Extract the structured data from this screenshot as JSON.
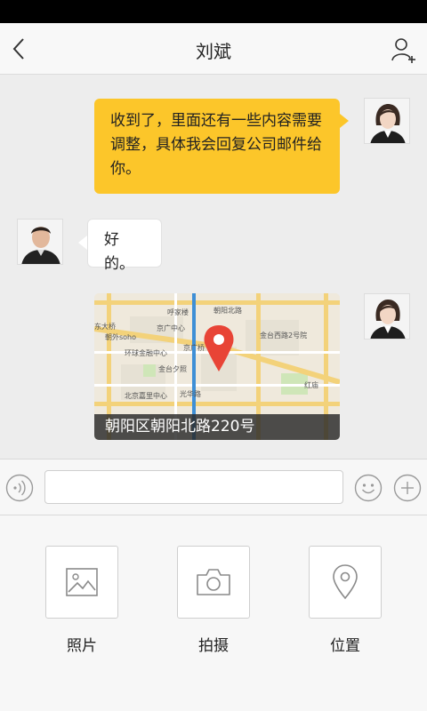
{
  "header": {
    "title": "刘斌"
  },
  "messages": [
    {
      "side": "right",
      "kind": "text",
      "text": "收到了，里面还有一些内容需要调整，具体我会回复公司邮件给你。"
    },
    {
      "side": "left",
      "kind": "text",
      "text": "好的。"
    },
    {
      "side": "right",
      "kind": "location",
      "address": "朝阳区朝阳北路220号",
      "map_labels": {
        "a": "呼家楼",
        "b": "朝阳北路",
        "c": "东大桥",
        "d": "朝外soho",
        "e": "京广中心",
        "f": "环球金融中心",
        "g": "金台夕照",
        "h": "金台西路2号院",
        "i": "北京嘉里中心",
        "j": "光华路",
        "k": "红庙",
        "l": "京广桥"
      }
    }
  ],
  "input": {
    "value": "",
    "placeholder": ""
  },
  "panel": {
    "items": [
      {
        "label": "照片",
        "icon": "image-icon"
      },
      {
        "label": "拍摄",
        "icon": "camera-icon"
      },
      {
        "label": "位置",
        "icon": "location-pin-icon"
      }
    ]
  },
  "colors": {
    "accent": "#fcc62a",
    "map_pin": "#e84436"
  }
}
